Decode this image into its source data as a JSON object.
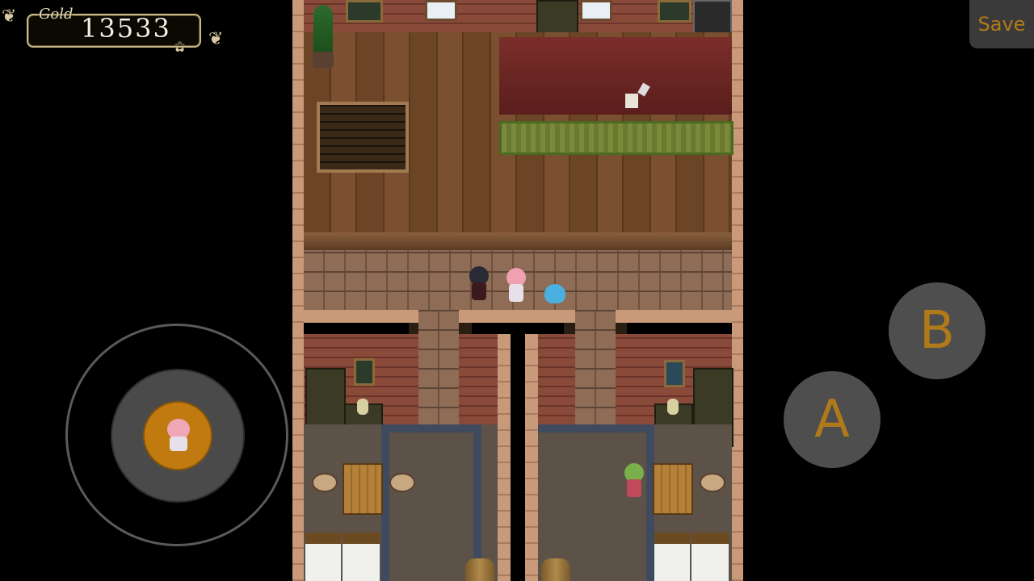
{
  "hud": {
    "gold_label": "Gold",
    "gold_value": "13533",
    "save_label": "Save"
  },
  "controls": {
    "a_label": "A",
    "b_label": "B"
  },
  "icons": {
    "joystick": "virtual-joystick",
    "knob_avatar": "pink-haired-girl-icon"
  },
  "colors": {
    "accent": "#b07a1a",
    "knob": "#c07a10"
  }
}
